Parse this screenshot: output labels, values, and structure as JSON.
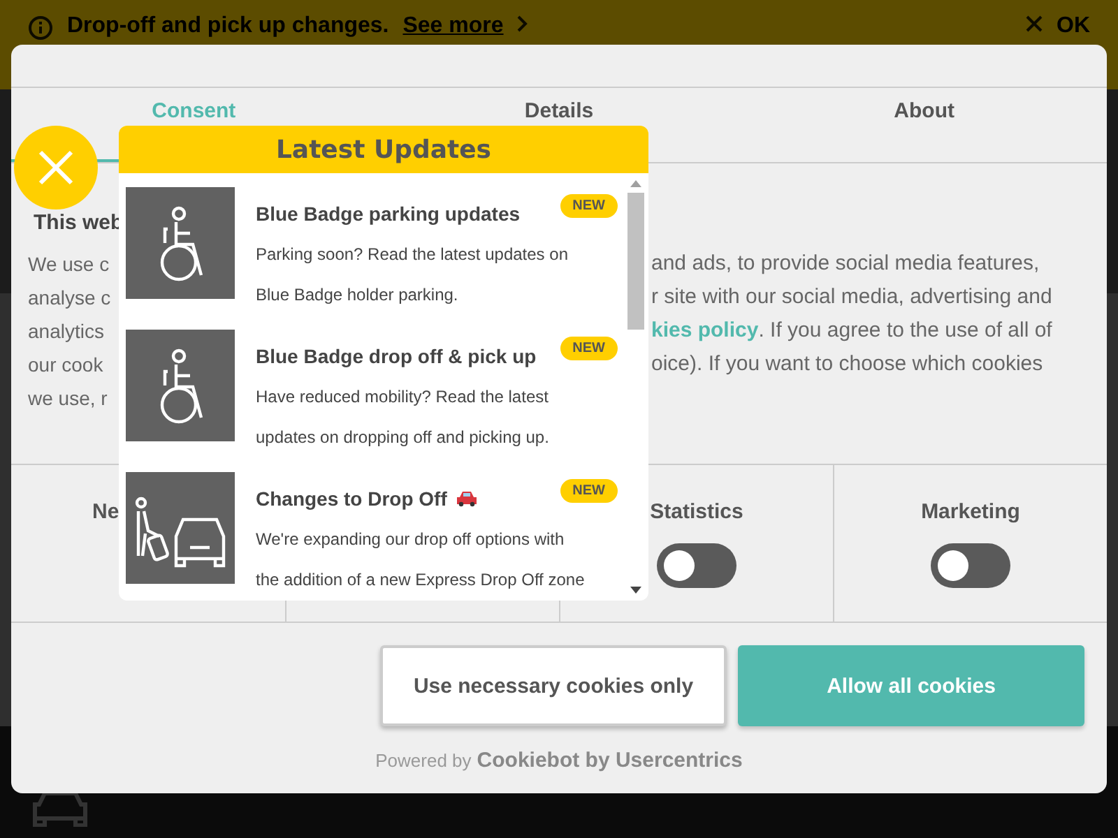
{
  "banner": {
    "message": "Drop-off and pick up changes.",
    "link": "See more",
    "dismiss": "OK"
  },
  "consent_dialog": {
    "tabs": [
      {
        "label": "Consent",
        "selected": true
      },
      {
        "label": "Details",
        "selected": false
      },
      {
        "label": "About",
        "selected": false
      }
    ],
    "heading": "This web",
    "lines": [
      {
        "left": "We use c",
        "right": "and ads, to provide social media features,"
      },
      {
        "left": "analyse c",
        "right": "r site with our social media, advertising and"
      },
      {
        "left": "analytics",
        "link": "kies policy",
        "right": ". If you agree to the use of all of"
      },
      {
        "left": "our cook",
        "right": "oice). If you want to choose which cookies"
      },
      {
        "left": "we use, r"
      }
    ],
    "categories": [
      {
        "label": "Ne"
      },
      {
        "label": "Statistics",
        "on": false
      },
      {
        "label": "Marketing",
        "on": false
      }
    ],
    "buttons": [
      {
        "label": "Use necessary cookies only",
        "kind": "secondary"
      },
      {
        "label": "Allow all cookies",
        "kind": "primary"
      }
    ],
    "powered_by": {
      "prefix": "Powered by",
      "brand": "Cookiebot by Usercentrics"
    }
  },
  "updates_popup": {
    "title": "Latest Updates",
    "items": [
      {
        "kind": "wheelchair",
        "title": "Blue Badge parking updates",
        "badge": "NEW",
        "lines": [
          "Parking soon? Read the latest updates on",
          "Blue Badge holder parking."
        ]
      },
      {
        "kind": "wheelchair",
        "title": "Blue Badge drop off & pick up",
        "badge": "NEW",
        "lines": [
          "Have reduced mobility? Read the latest",
          "updates on dropping off and picking up."
        ]
      },
      {
        "kind": "dropoff",
        "title": "Changes to Drop Off",
        "car": true,
        "badge": "NEW",
        "lines": [
          "We're expanding our drop off options with",
          "the addition of a new Express Drop Off zone"
        ]
      }
    ]
  }
}
